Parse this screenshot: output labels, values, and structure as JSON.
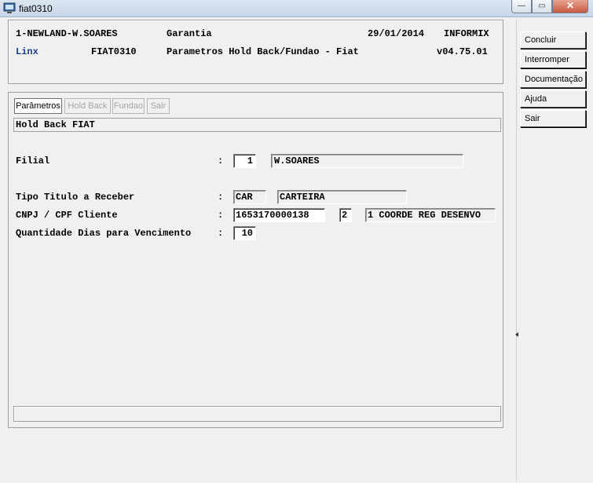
{
  "window": {
    "title": "fiat0310",
    "min": "—",
    "max": "▭",
    "close": "✕"
  },
  "header": {
    "line1": {
      "company": "1-NEWLAND-W.SOARES",
      "module": "Garantia",
      "date": "29/01/2014",
      "db": "INFORMIX"
    },
    "line2": {
      "brand": "Linx",
      "program": "FIAT0310",
      "description": "Parametros Hold Back/Fundao - Fiat",
      "version": "v04.75.01"
    }
  },
  "tabs": [
    {
      "label": "Parâmetros",
      "state": "active"
    },
    {
      "label": "Hold Back",
      "state": "disabled"
    },
    {
      "label": "Fundao",
      "state": "disabled"
    },
    {
      "label": "Sair",
      "state": "disabled"
    }
  ],
  "section_title": "Hold Back FIAT",
  "form": {
    "filial": {
      "label": "Filial",
      "colon": ":",
      "code": "1",
      "name": "W.SOARES"
    },
    "tipo_titulo": {
      "label": "Tipo Titulo a Receber",
      "colon": ":",
      "code": "CAR",
      "name": "CARTEIRA"
    },
    "cnpj": {
      "label": "CNPJ / CPF Cliente",
      "colon": ":",
      "number": "1653170000138",
      "suffix": "2",
      "name": "1 COORDE REG DESENVO"
    },
    "dias": {
      "label": "Quantidade Dias para Vencimento",
      "colon": ":",
      "value": "10"
    }
  },
  "side_buttons": [
    "Concluir",
    "Interromper",
    "Documentação",
    "Ajuda",
    "Sair"
  ],
  "colors": {
    "brand_text": "#1a3c8c",
    "background": "#f0f0f0"
  }
}
